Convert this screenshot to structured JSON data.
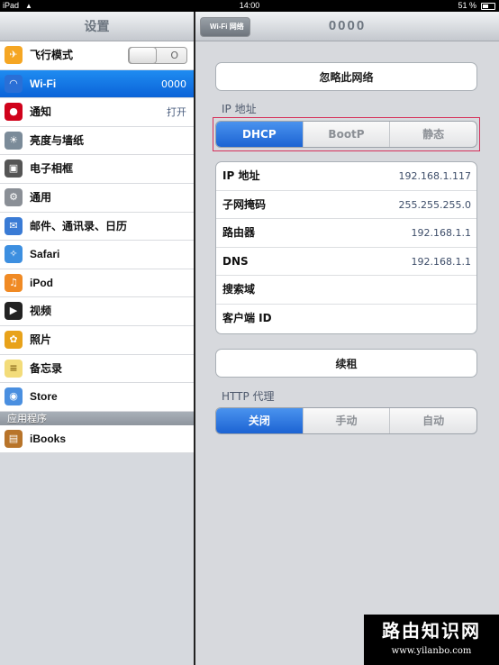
{
  "status_bar": {
    "carrier": "iPad",
    "time": "14:00",
    "battery": "51 %"
  },
  "master": {
    "title": "设置",
    "items": [
      {
        "label": "飞行模式",
        "icon": "airplane-icon",
        "toggle": "O"
      },
      {
        "label": "Wi-Fi",
        "icon": "wifi-icon",
        "value": "0000",
        "selected": true
      },
      {
        "label": "通知",
        "icon": "notifications-icon",
        "value": "打开"
      },
      {
        "label": "亮度与墙纸",
        "icon": "brightness-icon"
      },
      {
        "label": "电子相框",
        "icon": "picture-frame-icon"
      },
      {
        "label": "通用",
        "icon": "gear-icon"
      },
      {
        "label": "邮件、通讯录、日历",
        "icon": "mail-icon"
      },
      {
        "label": "Safari",
        "icon": "safari-icon"
      },
      {
        "label": "iPod",
        "icon": "ipod-icon"
      },
      {
        "label": "视频",
        "icon": "video-icon"
      },
      {
        "label": "照片",
        "icon": "photos-icon"
      },
      {
        "label": "备忘录",
        "icon": "notes-icon"
      },
      {
        "label": "Store",
        "icon": "store-icon"
      }
    ],
    "apps_section": "应用程序",
    "app_items": [
      {
        "label": "iBooks",
        "icon": "ibooks-icon"
      }
    ]
  },
  "detail": {
    "title": "0000",
    "back_label": "Wi-Fi 网络",
    "forget_label": "忽略此网络",
    "ip_section_label": "IP 地址",
    "ip_modes": [
      "DHCP",
      "BootP",
      "静态"
    ],
    "ip_mode_selected": 0,
    "ip_rows": [
      {
        "key": "IP 地址",
        "value": "192.168.1.117"
      },
      {
        "key": "子网掩码",
        "value": "255.255.255.0"
      },
      {
        "key": "路由器",
        "value": "192.168.1.1"
      },
      {
        "key": "DNS",
        "value": "192.168.1.1"
      },
      {
        "key": "搜索域",
        "value": ""
      },
      {
        "key": "客户端 ID",
        "value": ""
      }
    ],
    "renew_label": "续租",
    "proxy_section_label": "HTTP 代理",
    "proxy_modes": [
      "关闭",
      "手动",
      "自动"
    ],
    "proxy_selected": 0
  },
  "watermark": {
    "title": "路由知识网",
    "url": "www.yilanbo.com"
  },
  "colors": {
    "selection_blue": "#0b63d8",
    "segment_blue": "#1c63d3",
    "highlight_frame": "#d6315a"
  }
}
